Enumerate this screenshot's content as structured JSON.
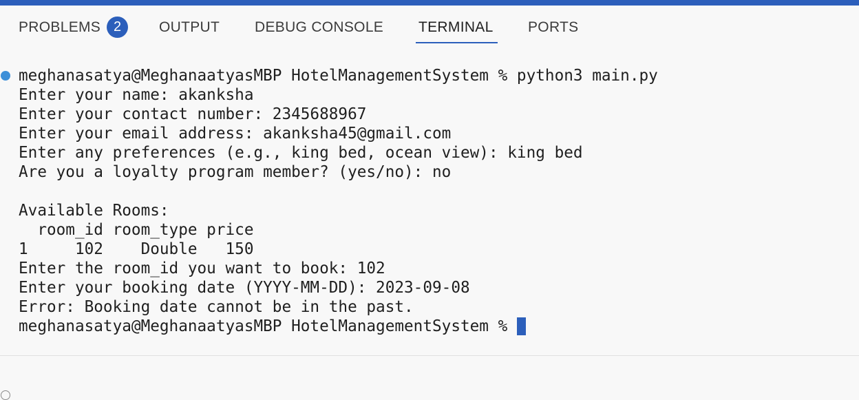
{
  "colors": {
    "accent": "#2c5fbb",
    "status_dot": "#3d8fd8",
    "text": "#1f1f1f",
    "background": "#f8f8f8"
  },
  "tabs": {
    "problems": "PROBLEMS",
    "problems_count": "2",
    "output": "OUTPUT",
    "debug_console": "DEBUG CONSOLE",
    "terminal": "TERMINAL",
    "ports": "PORTS",
    "active": "TERMINAL"
  },
  "terminal": {
    "lines": [
      "meghanasatya@MeghanaatyasMBP HotelManagementSystem % python3 main.py",
      "Enter your name: akanksha",
      "Enter your contact number: 2345688967",
      "Enter your email address: akanksha45@gmail.com",
      "Enter any preferences (e.g., king bed, ocean view): king bed",
      "Are you a loyalty program member? (yes/no): no",
      "",
      "Available Rooms:",
      "  room_id room_type price",
      "1     102    Double   150",
      "Enter the room_id you want to book: 102",
      "Enter your booking date (YYYY-MM-DD): 2023-09-08",
      "Error: Booking date cannot be in the past.",
      "meghanasatya@MeghanaatyasMBP HotelManagementSystem % "
    ],
    "status_icons": [
      "command-success-dot-icon",
      "command-pending-dot-icon"
    ],
    "cursor_icon": "terminal-cursor-icon"
  }
}
